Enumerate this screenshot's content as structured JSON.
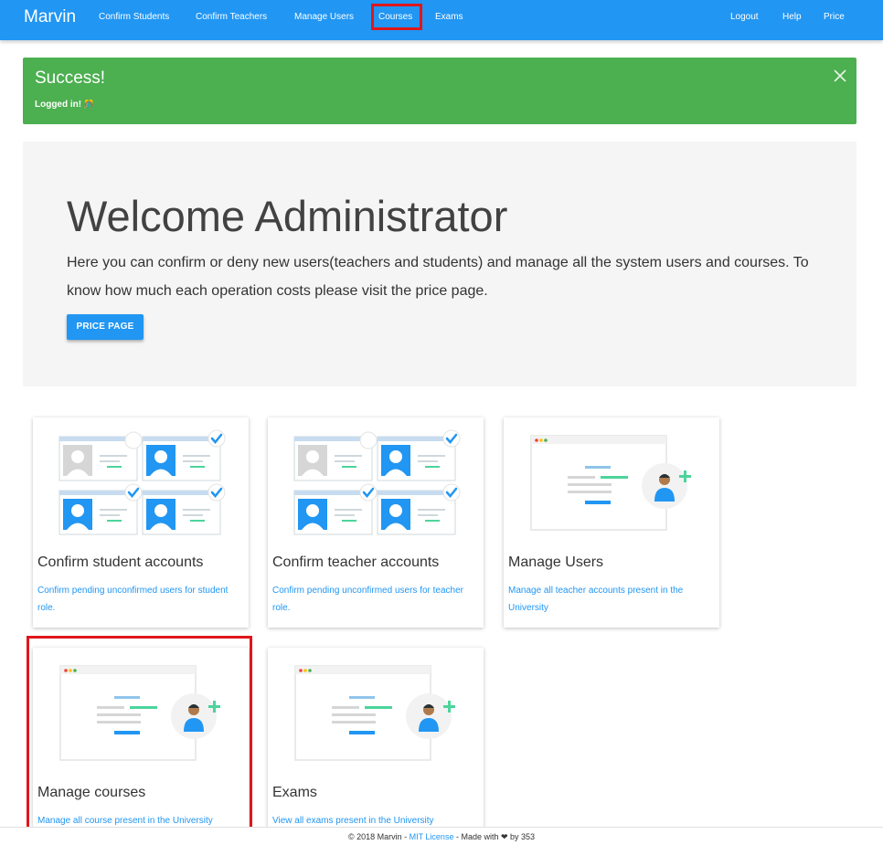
{
  "navbar": {
    "brand": "Marvin",
    "left_items": [
      "Confirm Students",
      "Confirm Teachers",
      "Manage Users",
      "Courses",
      "Exams"
    ],
    "right_items": [
      "Logout",
      "Help",
      "Price"
    ],
    "highlighted_item": "Courses",
    "color": "#2196f3"
  },
  "alert": {
    "title": "Success!",
    "message": "Logged in!",
    "emoji": "🎊",
    "color": "#4caf50"
  },
  "jumbotron": {
    "title": "Welcome Administrator",
    "text": "Here you can confirm or deny new users(teachers and students) and manage all the system users and courses. To know how much each operation costs please visit the price page.",
    "button": "PRICE PAGE"
  },
  "cards": [
    {
      "title": "Confirm student accounts",
      "description": "Confirm pending unconfirmed users for student role.",
      "image": "confirm-accounts-illustration"
    },
    {
      "title": "Confirm teacher accounts",
      "description": "Confirm pending unconfirmed users for teacher role.",
      "image": "confirm-accounts-illustration"
    },
    {
      "title": "Manage Users",
      "description": "Manage all teacher accounts present in the University",
      "image": "manage-users-illustration"
    },
    {
      "title": "Manage courses",
      "description": "Manage all course present in the University",
      "image": "manage-users-illustration",
      "highlighted": true
    },
    {
      "title": "Exams",
      "description": "View all exams present in the University",
      "image": "manage-users-illustration"
    }
  ],
  "footer": {
    "prefix": "© 2018 Marvin - ",
    "license": "MIT License",
    "middle": " - Made with ",
    "heart": "❤",
    "suffix": " by 353"
  },
  "highlight_color": "#e0161b"
}
